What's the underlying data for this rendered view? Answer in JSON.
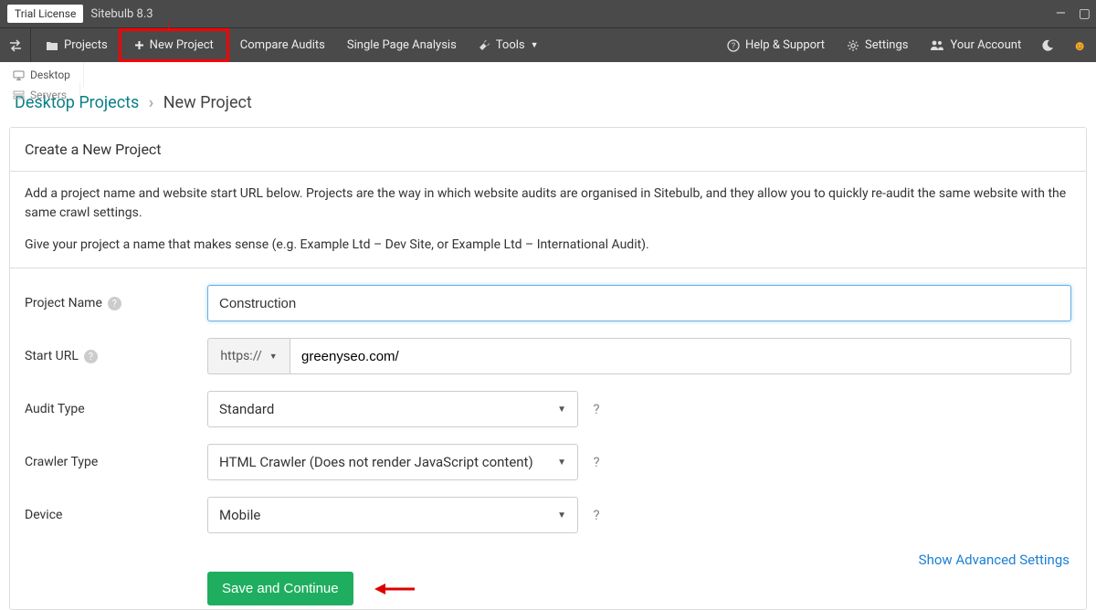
{
  "titlebar": {
    "license": "Trial License",
    "app": "Sitebulb 8.3"
  },
  "nav": {
    "projects": "Projects",
    "new_project": "New Project",
    "compare": "Compare Audits",
    "single_page": "Single Page Analysis",
    "tools": "Tools",
    "help": "Help & Support",
    "settings": "Settings",
    "account": "Your Account"
  },
  "tabs": {
    "desktop": "Desktop",
    "servers": "Servers"
  },
  "breadcrumb": {
    "root": "Desktop Projects",
    "current": "New Project"
  },
  "card": {
    "title": "Create a New Project",
    "help1": "Add a project name and website start URL below. Projects are the way in which website audits are organised in Sitebulb, and they allow you to quickly re-audit the same website with the same crawl settings.",
    "help2": "Give your project a name that makes sense (e.g. Example Ltd – Dev Site, or Example Ltd – International Audit)."
  },
  "form": {
    "project_name_label": "Project Name",
    "project_name_value": "Construction",
    "start_url_label": "Start URL",
    "protocol": "https://",
    "start_url_value": "greenyseo.com/",
    "audit_type_label": "Audit Type",
    "audit_type_value": "Standard",
    "crawler_type_label": "Crawler Type",
    "crawler_type_value": "HTML Crawler (Does not render JavaScript content)",
    "device_label": "Device",
    "device_value": "Mobile",
    "advanced_link": "Show Advanced Settings",
    "save_btn": "Save and Continue"
  }
}
